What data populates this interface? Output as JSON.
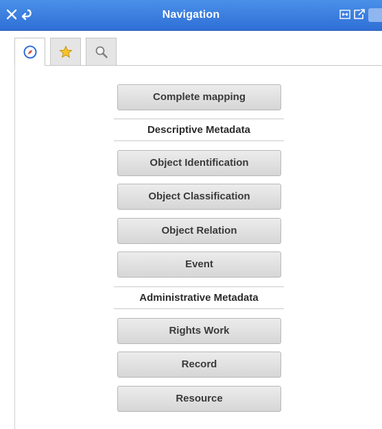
{
  "window": {
    "title": "Navigation",
    "accent_color": "#3a7fe0",
    "controls": [
      {
        "icon": "close-icon"
      },
      {
        "icon": "undock-arrow-icon"
      },
      {
        "icon": "expand-icon"
      },
      {
        "icon": "popout-icon"
      }
    ]
  },
  "tabs": [
    {
      "icon": "compass-icon",
      "active": true
    },
    {
      "icon": "star-icon",
      "active": false
    },
    {
      "icon": "magnifier-icon",
      "active": false
    }
  ],
  "panel": {
    "complete_mapping_label": "Complete mapping",
    "descriptive_header": "Descriptive Metadata",
    "descriptive_items": [
      {
        "label": "Object Identification"
      },
      {
        "label": "Object Classification"
      },
      {
        "label": "Object Relation"
      },
      {
        "label": "Event"
      }
    ],
    "administrative_header": "Administrative Metadata",
    "administrative_items": [
      {
        "label": "Rights Work"
      },
      {
        "label": "Record"
      },
      {
        "label": "Resource"
      }
    ]
  }
}
